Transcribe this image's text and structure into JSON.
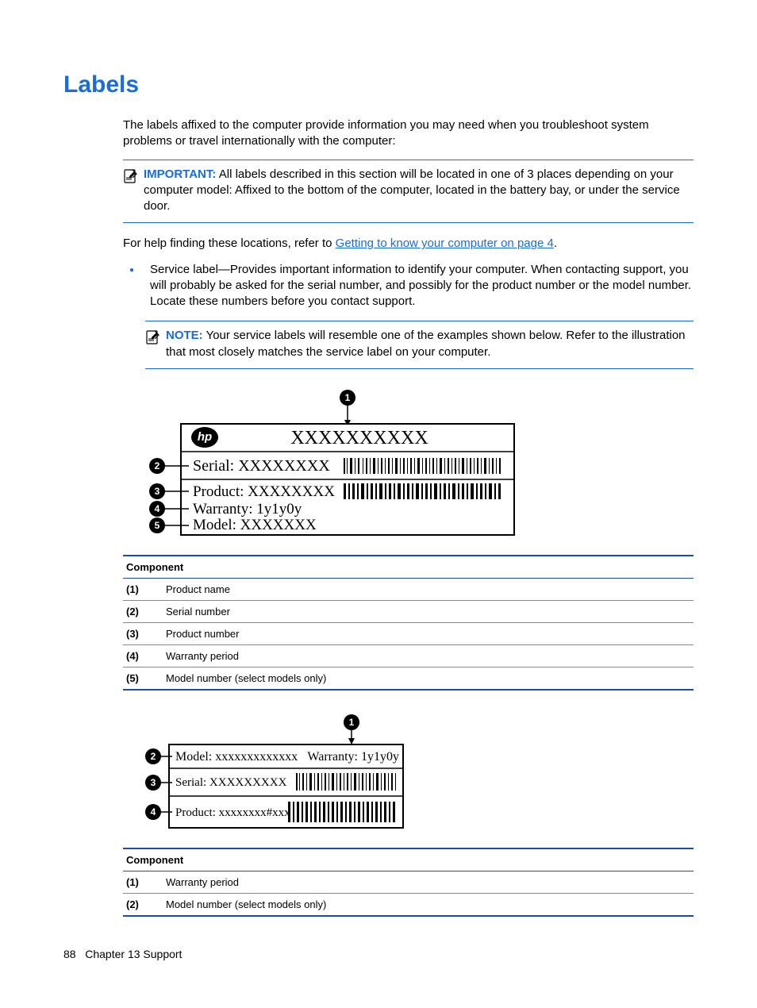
{
  "heading": "Labels",
  "intro": "The labels affixed to the computer provide information you may need when you troubleshoot system problems or travel internationally with the computer:",
  "important": {
    "label": "IMPORTANT:",
    "text": "All labels described in this section will be located in one of 3 places depending on your computer model: Affixed to the bottom of the computer, located in the battery bay, or under the service door."
  },
  "help_prefix": "For help finding these locations, refer to ",
  "help_link": "Getting to know your computer on page 4",
  "help_suffix": ".",
  "bullet": "Service label—Provides important information to identify your computer. When contacting support, you will probably be asked for the serial number, and possibly for the product number or the model number. Locate these numbers before you contact support.",
  "note": {
    "label": "NOTE:",
    "text": "Your service labels will resemble one of the examples shown below. Refer to the illustration that most closely matches the service label on your computer."
  },
  "diagram1": {
    "product_name": "XXXXXXXXXX",
    "serial_label": "Serial:",
    "serial_value": "XXXXXXXX",
    "product_label": "Product:",
    "product_value": "XXXXXXXX",
    "warranty_label": "Warranty:",
    "warranty_value": "1y1y0y",
    "model_label": "Model:",
    "model_value": "XXXXXXX"
  },
  "table1": {
    "header": "Component",
    "rows": [
      {
        "n": "(1)",
        "d": "Product name"
      },
      {
        "n": "(2)",
        "d": "Serial number"
      },
      {
        "n": "(3)",
        "d": "Product number"
      },
      {
        "n": "(4)",
        "d": "Warranty period"
      },
      {
        "n": "(5)",
        "d": "Model number (select models only)"
      }
    ]
  },
  "diagram2": {
    "model_label": "Model:",
    "model_value": "xxxxxxxxxxxxx",
    "warranty_label": "Warranty:",
    "warranty_value": "1y1y0y",
    "serial_label": "Serial:",
    "serial_value": "XXXXXXXXX",
    "product_label": "Product:",
    "product_value": "xxxxxxxx#xxx"
  },
  "table2": {
    "header": "Component",
    "rows": [
      {
        "n": "(1)",
        "d": "Warranty period"
      },
      {
        "n": "(2)",
        "d": "Model number (select models only)"
      }
    ]
  },
  "footer": {
    "page": "88",
    "chapter": "Chapter 13   Support"
  }
}
